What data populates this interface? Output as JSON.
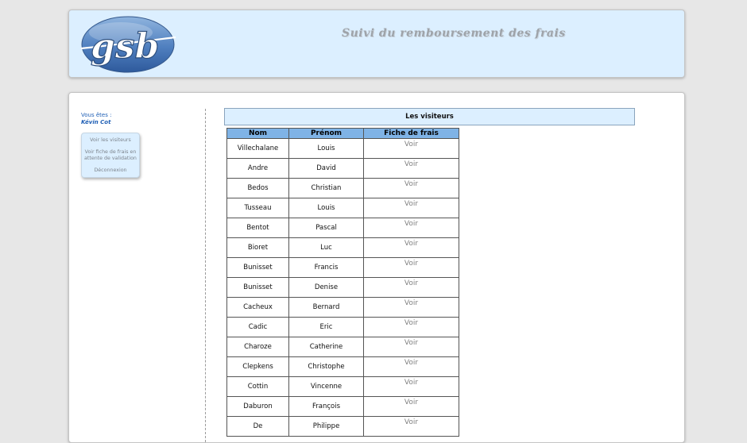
{
  "header": {
    "logo_text": "gsb",
    "tagline": "Suivi du remboursement des frais"
  },
  "sidebar": {
    "user_label": "Vous êtes :",
    "user_name": "Kévin Cot",
    "menu": [
      {
        "label": "Voir les visiteurs"
      },
      {
        "label": "Voir fiche de frais en attente de validation"
      },
      {
        "label": "Déconnexion"
      }
    ]
  },
  "main": {
    "title": "Les visiteurs",
    "columns": [
      "Nom",
      "Prénom",
      "Fiche de frais"
    ],
    "action_label": "Voir",
    "rows": [
      {
        "nom": "Villechalane",
        "prenom": "Louis"
      },
      {
        "nom": "Andre",
        "prenom": "David"
      },
      {
        "nom": "Bedos",
        "prenom": "Christian"
      },
      {
        "nom": "Tusseau",
        "prenom": "Louis"
      },
      {
        "nom": "Bentot",
        "prenom": "Pascal"
      },
      {
        "nom": "Bioret",
        "prenom": "Luc"
      },
      {
        "nom": "Bunisset",
        "prenom": "Francis"
      },
      {
        "nom": "Bunisset",
        "prenom": "Denise"
      },
      {
        "nom": "Cacheux",
        "prenom": "Bernard"
      },
      {
        "nom": "Cadic",
        "prenom": "Eric"
      },
      {
        "nom": "Charoze",
        "prenom": "Catherine"
      },
      {
        "nom": "Clepkens",
        "prenom": "Christophe"
      },
      {
        "nom": "Cottin",
        "prenom": "Vincenne"
      },
      {
        "nom": "Daburon",
        "prenom": "François"
      },
      {
        "nom": "De",
        "prenom": "Philippe"
      }
    ]
  },
  "colors": {
    "page_background": "#e7e7e7",
    "panel_blue": "#dcefff",
    "table_header": "#7fb3e6",
    "user_text": "#1f5fb5"
  }
}
